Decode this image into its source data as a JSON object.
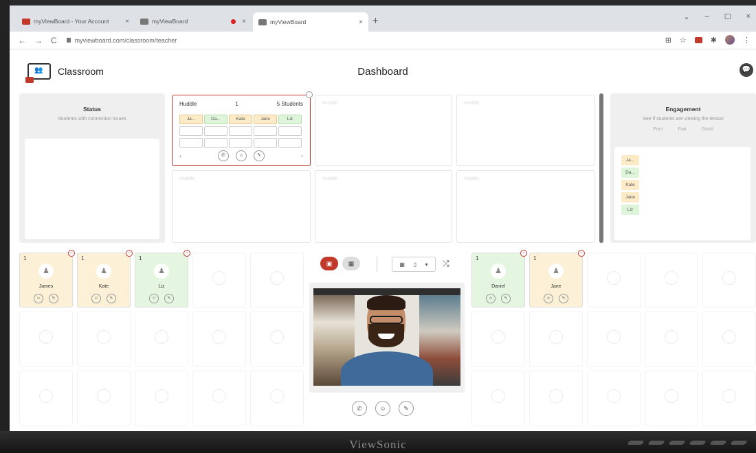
{
  "browser": {
    "tabs": [
      {
        "title": "myViewBoard - Your Account",
        "active": false
      },
      {
        "title": "myViewBoard",
        "active": false
      },
      {
        "title": "myViewBoard",
        "active": true
      }
    ],
    "url": "myviewboard.com/classroom/teacher",
    "new_tab": "+",
    "back": "←",
    "forward": "→",
    "reload": "C",
    "close": "×",
    "minimize": "–",
    "maximize": "☐",
    "chevron": "⌄"
  },
  "header": {
    "app_title": "Classroom",
    "page_title": "Dashboard"
  },
  "status_panel": {
    "title": "Status",
    "subtitle": "Students with connection issues"
  },
  "huddle": {
    "label": "Huddle",
    "number": "1",
    "students": "5 Students",
    "members": [
      {
        "name": "Ja...",
        "tone": "y"
      },
      {
        "name": "Da...",
        "tone": "g"
      },
      {
        "name": "Kate",
        "tone": "y"
      },
      {
        "name": "Jane",
        "tone": "y"
      },
      {
        "name": "Liz",
        "tone": "g"
      }
    ],
    "ghost_label": "Huddle"
  },
  "engagement": {
    "title": "Engagement",
    "subtitle": "See if students are viewing the lesson",
    "legend": [
      "Poor",
      "Fair",
      "Good"
    ],
    "students": [
      {
        "name": "Ja...",
        "tone": "y"
      },
      {
        "name": "Da...",
        "tone": "g"
      },
      {
        "name": "Kate",
        "tone": "y"
      },
      {
        "name": "Jane",
        "tone": "y"
      },
      {
        "name": "Liz",
        "tone": "g"
      }
    ]
  },
  "seats": [
    {
      "name": "James",
      "num": "1",
      "tone": "y"
    },
    {
      "name": "Kate",
      "num": "1",
      "tone": "y"
    },
    {
      "name": "Liz",
      "num": "1",
      "tone": "g"
    },
    {
      "name": "Daniel",
      "num": "1",
      "tone": "g"
    },
    {
      "name": "Jane",
      "num": "1",
      "tone": "y"
    }
  ],
  "icons": {
    "call": "✆",
    "user": "☺",
    "pen": "✎",
    "person": "♟",
    "minus": "–",
    "prev": "‹",
    "next": "›",
    "shuffle": "⤮",
    "dropdown": "▾",
    "chat": "💬"
  },
  "brand": "ViewSonic",
  "colors": {
    "accent": "#c0392b",
    "seat_yellow": "#fcf0d6",
    "seat_green": "#e4f6df"
  }
}
